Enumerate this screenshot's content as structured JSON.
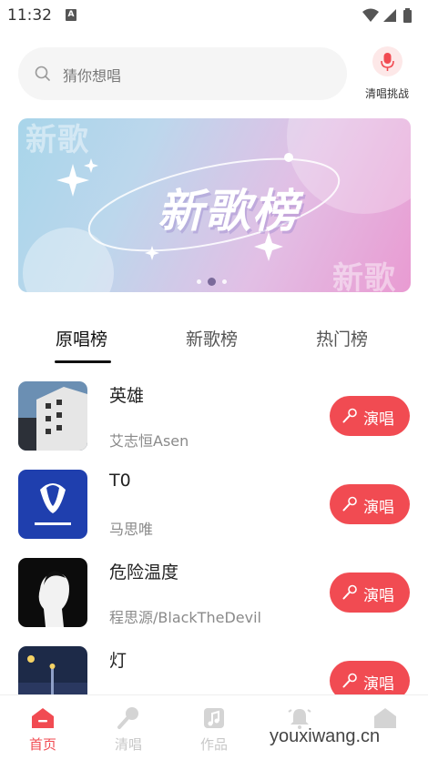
{
  "status_bar": {
    "time": "11:32",
    "notification_badge": "A"
  },
  "search": {
    "placeholder": "猜你想唱"
  },
  "challenge": {
    "label": "清唱挑战",
    "icon": "microphone-icon"
  },
  "banner": {
    "title": "新歌榜",
    "watermark_top": "新歌",
    "watermark_bottom": "新歌",
    "slide_count": 3,
    "active_slide": 2
  },
  "tabs": [
    {
      "label": "原唱榜",
      "active": true
    },
    {
      "label": "新歌榜",
      "active": false
    },
    {
      "label": "热门榜",
      "active": false
    }
  ],
  "songs": [
    {
      "title": "英雄",
      "artist": "艾志恒Asen",
      "button": "演唱"
    },
    {
      "title": "T0",
      "artist": "马思唯",
      "button": "演唱"
    },
    {
      "title": "危险温度",
      "artist": "程思源/BlackTheDevil",
      "button": "演唱"
    },
    {
      "title": "灯",
      "artist": "",
      "button": "演唱"
    }
  ],
  "nav": [
    {
      "label": "首页",
      "icon": "home-icon",
      "active": true
    },
    {
      "label": "清唱",
      "icon": "microphone-icon",
      "active": false
    },
    {
      "label": "作品",
      "icon": "music-note-icon",
      "active": false
    },
    {
      "label": "",
      "icon": "bell-icon",
      "active": false
    },
    {
      "label": "",
      "icon": "house-icon",
      "active": false
    }
  ],
  "watermark": "youxiwang.cn",
  "colors": {
    "accent": "#f14b52",
    "text": "#222222",
    "muted": "#8a8a8a"
  }
}
